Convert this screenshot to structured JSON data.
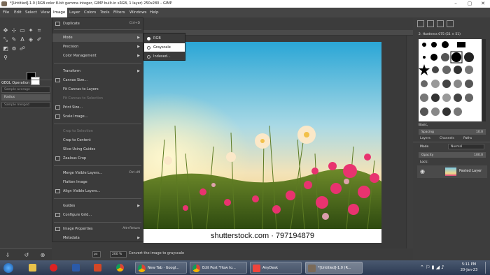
{
  "window": {
    "title": "*[Untitled]-1.0 (RGB color 8-bit gamma integer, GIMP built-in sRGB, 1 layer) 250x280 – GIMP",
    "controls": [
      "–",
      "▢",
      "✕"
    ]
  },
  "menubar": [
    "File",
    "Edit",
    "Select",
    "View",
    "Image",
    "Layer",
    "Colors",
    "Tools",
    "Filters",
    "Windows",
    "Help"
  ],
  "toolbox": {
    "gegl_title": "GEGL Operation",
    "sample_average": "Sample average",
    "radius_label": "Radius",
    "sample_merged": "Sample merged"
  },
  "image_menu": {
    "items": [
      {
        "label": "Duplicate",
        "shortcut": "Ctrl+D",
        "disabled": false
      },
      {
        "label": "Mode",
        "submenu": true,
        "highlighted": true
      },
      {
        "label": "Precision",
        "submenu": true
      },
      {
        "label": "Color Management",
        "submenu": true
      },
      {
        "label": "Transform",
        "submenu": true
      },
      {
        "label": "Canvas Size..."
      },
      {
        "label": "Fit Canvas to Layers"
      },
      {
        "label": "Fit Canvas to Selection",
        "disabled": true
      },
      {
        "label": "Print Size..."
      },
      {
        "label": "Scale Image..."
      },
      {
        "label": "Crop to Selection",
        "disabled": true
      },
      {
        "label": "Crop to Content"
      },
      {
        "label": "Slice Using Guides"
      },
      {
        "label": "Zealous Crop"
      },
      {
        "label": "Merge Visible Layers...",
        "shortcut": "Ctrl+M"
      },
      {
        "label": "Flatten Image"
      },
      {
        "label": "Align Visible Layers..."
      },
      {
        "label": "Guides",
        "submenu": true
      },
      {
        "label": "Configure Grid..."
      },
      {
        "label": "Image Properties",
        "shortcut": "Alt+Return"
      },
      {
        "label": "Metadata",
        "submenu": true
      }
    ]
  },
  "mode_submenu": {
    "items": [
      {
        "label": "RGB",
        "selected": true
      },
      {
        "label": "Grayscale",
        "highlighted": true
      },
      {
        "label": "Indexed..."
      }
    ]
  },
  "canvas": {
    "watermark": "shutterstock.com · 797194879"
  },
  "statusbar": {
    "unit": "px",
    "zoom": "200 %",
    "message": "Convert the image to grayscale"
  },
  "right_panel": {
    "brush_name": "2. Hardness 075 (51 × 51)",
    "basic_label": "Basic,",
    "spacing_label": "Spacing",
    "spacing_value": "10.0",
    "tabs": [
      "Layers",
      "Channels",
      "Paths"
    ],
    "mode_label": "Mode",
    "mode_value": "Normal",
    "opacity_label": "Opacity",
    "opacity_value": "100.0",
    "lock_label": "Lock:",
    "layer_name": "Pasted Layer"
  },
  "taskbar": {
    "apps": [
      {
        "label": "New Tab · Googl..."
      },
      {
        "label": "Edit Post \"How to..."
      },
      {
        "label": "AnyDesk"
      },
      {
        "label": "*[Untitled]-1.0 (R..."
      }
    ],
    "time": "5:11 PM",
    "date": "20-Jan-23"
  },
  "colors": {
    "menu_bg": "#3b3b3b",
    "highlight": "#ffffff",
    "sky_top": "#3fb0d6",
    "flower_pink": "#e8336f"
  }
}
